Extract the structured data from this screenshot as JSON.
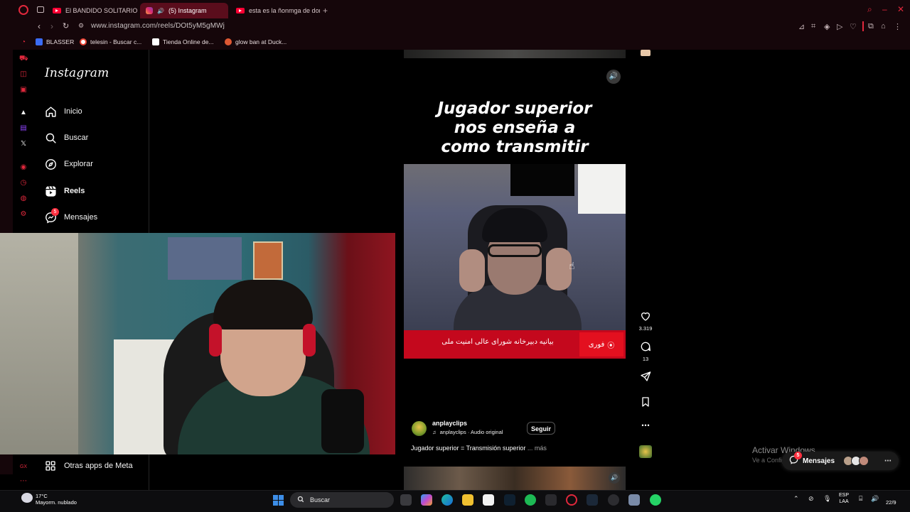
{
  "browser": {
    "tabs": [
      {
        "title": "El BANDIDO SOLITARIO m",
        "favicon": "youtube-icon"
      },
      {
        "title": "(5) Instagram",
        "favicon": "instagram-icon",
        "active": true
      },
      {
        "title": "esta es la ñonmga de don",
        "favicon": "youtube-icon"
      }
    ],
    "url": "www.instagram.com/reels/DOt5yM5gMWj",
    "bookmarks": [
      {
        "label": "BLASSER",
        "color": "#3b6cf5"
      },
      {
        "label": "telesin - Buscar c...",
        "color": "#ea4335"
      },
      {
        "label": "Tienda Online de...",
        "color": "#ffffff"
      },
      {
        "label": "glow ban at Duck...",
        "color": "#de5833"
      }
    ],
    "accent": "#e0283c"
  },
  "instagram": {
    "logo": "Instagram",
    "nav": [
      {
        "label": "Inicio",
        "icon": "home-icon"
      },
      {
        "label": "Buscar",
        "icon": "search-icon"
      },
      {
        "label": "Explorar",
        "icon": "compass-icon"
      },
      {
        "label": "Reels",
        "icon": "reels-icon",
        "active": true
      },
      {
        "label": "Mensajes",
        "icon": "messenger-icon",
        "badge": "5"
      }
    ],
    "other_apps": "Otras apps de Meta"
  },
  "reel": {
    "caption_lines": [
      "Jugador superior",
      "nos enseña a",
      "como transmitir"
    ],
    "news_text": "بیانیه دبیرخانه شورای عالی امنیت ملی",
    "news_logo": "فوری",
    "likes": "3.319",
    "comments": "13",
    "author": "anplayclips",
    "audio": "anplayclips · Audio original",
    "follow_label": "Seguir",
    "description": "Jugador superior = Transmisión superior",
    "more_label": "... más"
  },
  "messages_pill": {
    "label": "Mensajes",
    "badge": "5"
  },
  "watermark": {
    "title": "Activar Windows",
    "subtitle": "Ve a Configuración para activar Windows."
  },
  "taskbar": {
    "temperature": "17°C",
    "weather": "Mayorm. nublado",
    "search_placeholder": "Buscar",
    "lang_top": "ESP",
    "lang_bottom": "LAA",
    "clock": "22/9"
  }
}
